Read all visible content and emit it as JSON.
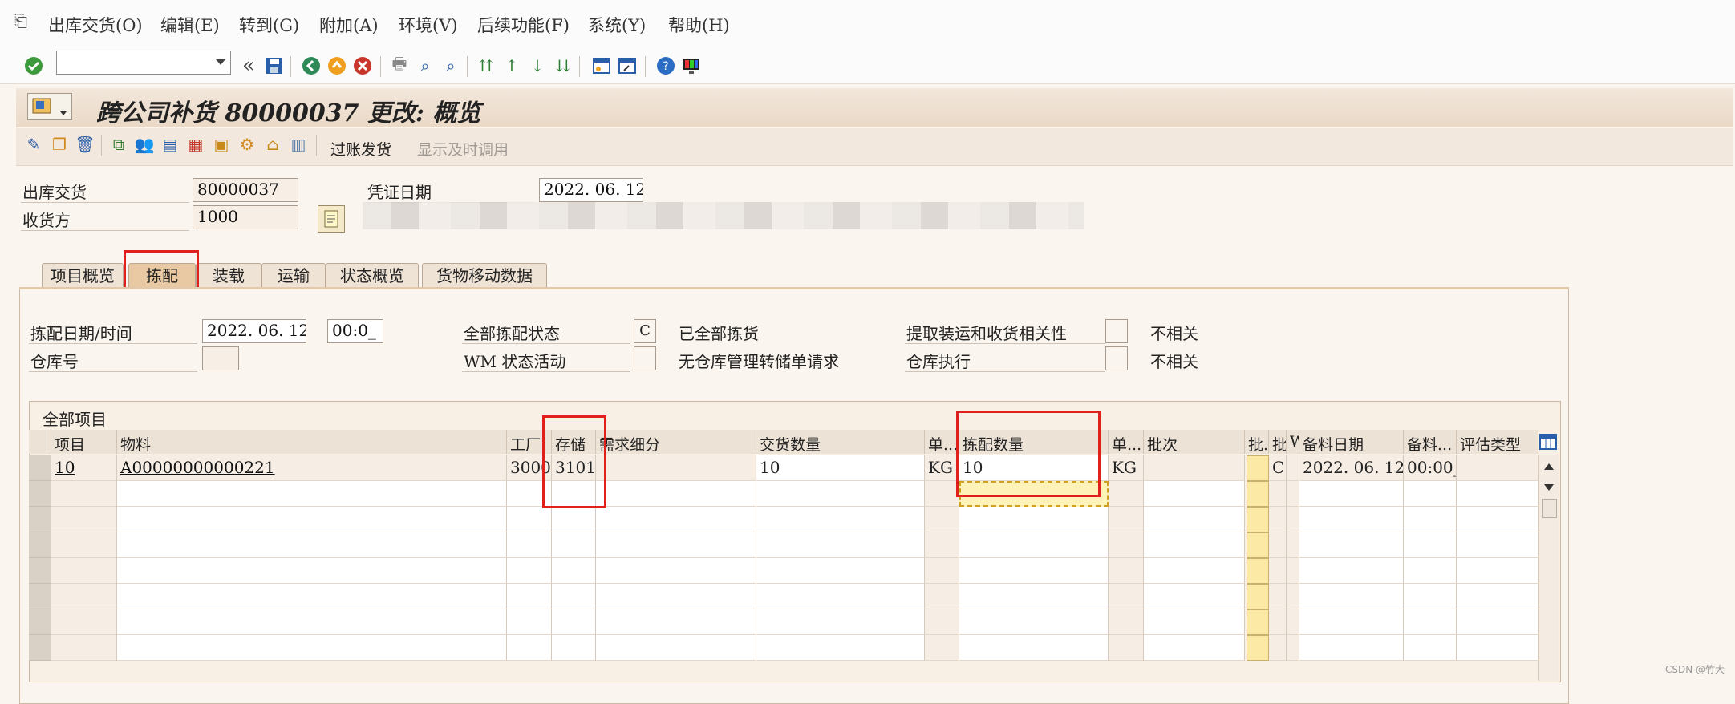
{
  "menu": [
    "出库交货(O)",
    "编辑(E)",
    "转到(G)",
    "附加(A)",
    "环境(V)",
    "后续功能(F)",
    "系统(Y)",
    "帮助(H)"
  ],
  "toolbar": {
    "command_value": "",
    "back_chevron": "«"
  },
  "title": "跨公司补货 80000037 更改: 概览",
  "app_toolbar": {
    "post_gi_label": "过账发货",
    "display_time_label": "显示及时调用"
  },
  "header": {
    "delivery_label": "出库交货",
    "delivery_value": "80000037",
    "doc_date_label": "凭证日期",
    "doc_date_value": "2022. 06. 12",
    "ship_to_label": "收货方",
    "ship_to_value": "1000"
  },
  "tabs": [
    "项目概览",
    "拣配",
    "装载",
    "运输",
    "状态概览",
    "货物移动数据"
  ],
  "picking": {
    "pick_date_label": "拣配日期/时间",
    "pick_date_value": "2022. 06. 12",
    "pick_time_value": "00:0_",
    "warehouse_label": "仓库号",
    "warehouse_value": "",
    "overall_pick_status_label": "全部拣配状态",
    "overall_pick_status_value": "C",
    "overall_pick_status_text": "已全部拣货",
    "wm_activity_label": "WM 状态活动",
    "wm_activity_value": "",
    "wm_activity_text": "无仓库管理转储单请求",
    "pickup_relevance_label": "提取装运和收货相关性",
    "pickup_relevance_value": "",
    "pickup_relevance_text": "不相关",
    "warehouse_exec_label": "仓库执行",
    "warehouse_exec_value": "",
    "warehouse_exec_text": "不相关"
  },
  "table": {
    "title": "全部项目",
    "headers": [
      "项目",
      "物料",
      "工厂",
      "存储",
      "需求细分",
      "交货数量",
      "单...",
      "拣配数量",
      "单...",
      "批次",
      "批.",
      "批",
      "W",
      "备料日期",
      "备料...",
      "评估类型"
    ],
    "rows": [
      {
        "item": "10",
        "material": "A00000000000221",
        "plant": "3000",
        "storage": "3101",
        "req_seg": "",
        "deliv_qty": "10",
        "unit1": "KG",
        "pick_qty": "10",
        "unit2": "KG",
        "batch": "",
        "b1": "",
        "b2": "C",
        "w": "",
        "date": "2022. 06. 12",
        "time": "00:00_",
        "val_type": ""
      }
    ]
  },
  "watermark": "CSDN @竹大"
}
